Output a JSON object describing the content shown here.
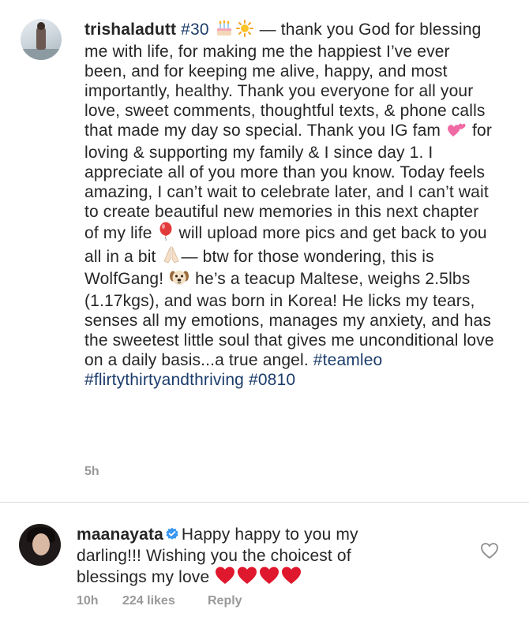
{
  "post": {
    "username": "trishaladutt",
    "caption_segments": {
      "tag1": "#30",
      "t1": " — thank you God for blessing me with life, for making me the happiest I’ve ever been, and for keeping me alive, happy, and most importantly, healthy. Thank you everyone for all your love, sweet comments, thoughtful texts, & phone calls that made my day so special. Thank you IG fam ",
      "t2": " for loving & supporting my family & I since day 1. I appreciate all of you more than you know. Today feels amazing, I can’t wait to celebrate later, and I can’t wait to create beautiful new memories in this next chapter of my life ",
      "t3": " will upload more pics and get back to you all in a bit ",
      "t4": "— btw for those wondering, this is WolfGang! ",
      "t5": " he’s a teacup Maltese, weighs 2.5lbs (1.17kgs), and was born in Korea! He licks my tears, senses all my emotions, manages my anxiety, and has the sweetest little soul that gives me unconditional love on a daily basis...a true angel. ",
      "tag2": "#teamleo",
      "tag3": "#flirtythirtyandthriving",
      "tag4": "#0810"
    },
    "emojis": [
      "birthday-cake-icon",
      "sun-icon",
      "two-hearts-icon",
      "balloon-icon",
      "folded-hands-icon",
      "dog-face-icon"
    ],
    "timestamp": "5h"
  },
  "comment": {
    "username": "maanayata",
    "verified": true,
    "text": "Happy happy to you my darling!!! Wishing you the choicest of blessings my love ",
    "emojis": [
      "red-heart-icon",
      "red-heart-icon",
      "red-heart-icon",
      "red-heart-icon"
    ],
    "time": "10h",
    "likes": "224 likes",
    "reply_label": "Reply"
  },
  "colors": {
    "hashtag": "#1b3c6b",
    "meta_gray": "#999999",
    "verified_blue": "#3897f0",
    "heart_red": "#e0182d",
    "divider": "#dbdbdb"
  }
}
